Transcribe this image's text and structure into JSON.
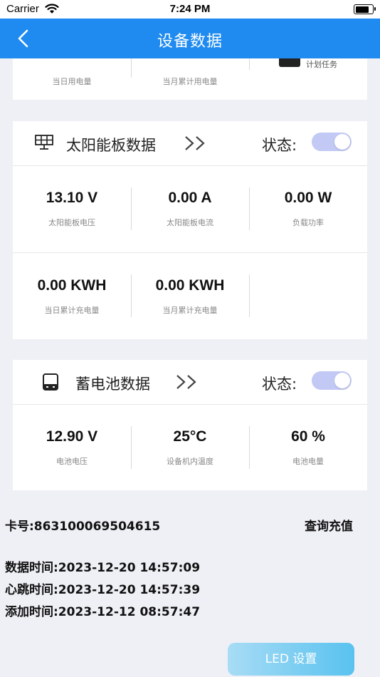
{
  "status_bar": {
    "carrier": "Carrier",
    "time": "7:24 PM"
  },
  "nav": {
    "title": "设备数据"
  },
  "top_card": {
    "labels": [
      "当日用电量",
      "当月累计用电量"
    ],
    "task_label": "计划任务"
  },
  "solar": {
    "title": "太阳能板数据",
    "chevron": ">>",
    "state_label": "状态:",
    "row1": [
      {
        "value": "13.10 V",
        "label": "太阳能板电压"
      },
      {
        "value": "0.00 A",
        "label": "太阳能板电流"
      },
      {
        "value": "0.00 W",
        "label": "负载功率"
      }
    ],
    "row2": [
      {
        "value": "0.00 KWH",
        "label": "当日累计充电量"
      },
      {
        "value": "0.00 KWH",
        "label": "当月累计充电量"
      }
    ]
  },
  "battery": {
    "title": "蓄电池数据",
    "chevron": ">>",
    "state_label": "状态:",
    "row1": [
      {
        "value": "12.90 V",
        "label": "电池电压"
      },
      {
        "value": "25°C",
        "label": "设备机内温度"
      },
      {
        "value": "60 %",
        "label": "电池电量"
      }
    ]
  },
  "info": {
    "card_no": "卡号:863100069504615",
    "query": "查询充值",
    "data_time": "数据时间:2023-12-20 14:57:09",
    "heartbeat_time": "心跳时间:2023-12-20 14:57:39",
    "added_time": "添加时间:2023-12-12 08:57:47"
  },
  "led_button": {
    "label": "LED 设置"
  },
  "colors": {
    "nav": "#1f8bf0",
    "toggle": "#c2c9f4",
    "button_start": "#a8dcf5",
    "button_end": "#59c2ef"
  },
  "icons": [
    "wifi-icon",
    "battery-icon",
    "back-arrow-icon",
    "solar-panel-icon",
    "chevron-double-right-icon",
    "storage-battery-icon",
    "schedule-task-icon"
  ]
}
